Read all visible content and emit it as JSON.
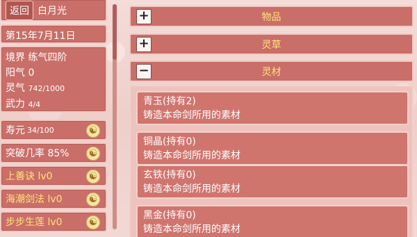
{
  "header": {
    "back_label": "返回",
    "name": "白月光"
  },
  "date": "第15年7月11日",
  "stats": {
    "realm": "境界 练气四阶",
    "yang_label": "阳气",
    "yang_value": "0",
    "ling_label": "灵气",
    "ling_value": "742/1000",
    "wuli_label": "武力",
    "wuli_value": "4/4"
  },
  "slots": [
    {
      "label": "寿元",
      "value": "34/100"
    },
    {
      "label": "突破几率 85%",
      "value": ""
    },
    {
      "label": "上善诀 lv0",
      "value": ""
    },
    {
      "label": "海潮剑法 lv0",
      "value": ""
    },
    {
      "label": "步步生莲 lv0",
      "value": ""
    }
  ],
  "categories": [
    {
      "sign": "+",
      "label": "物品"
    },
    {
      "sign": "+",
      "label": "灵草"
    },
    {
      "sign": "−",
      "label": "灵材"
    }
  ],
  "items": [
    {
      "name": "青玉(持有2)",
      "desc": "铸造本命剑所用的素材"
    },
    {
      "name": "铜晶(持有0)",
      "desc": "铸造本命剑所用的素材"
    },
    {
      "name": "玄铁(持有0)",
      "desc": "铸造本命剑所用的素材"
    },
    {
      "name": "黑金(持有0)",
      "desc": "铸造本命剑所用的素材"
    }
  ],
  "icons": {
    "yin_yang": "yin-yang-icon"
  },
  "colors": {
    "panel": "#c96e68",
    "accent_text": "#ffe47a",
    "background": "#f0d4cf"
  }
}
